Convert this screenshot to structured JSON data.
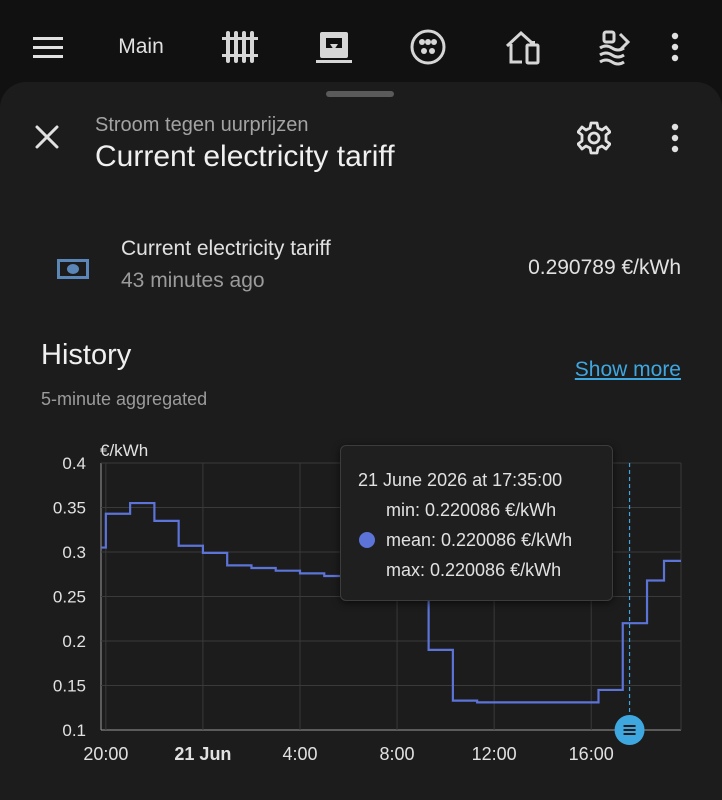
{
  "topbar": {
    "tab_label": "Main",
    "icons": [
      "menu-icon",
      "radiator-icon",
      "solar-inverter-icon",
      "ev-plug-icon",
      "home-battery-icon",
      "heat-pump-icon",
      "more-vertical-icon"
    ]
  },
  "dialog": {
    "subtitle": "Stroom tegen uurprijzen",
    "title": "Current electricity tariff"
  },
  "entity": {
    "name": "Current electricity tariff",
    "last_changed": "43 minutes ago",
    "state": "0.290789 €/kWh",
    "icon": "cash-icon"
  },
  "history": {
    "title": "History",
    "subtitle": "5-minute aggregated",
    "show_more": "Show more"
  },
  "tooltip": {
    "time": "21 June 2026 at 17:35:00",
    "min": "min: 0.220086 €/kWh",
    "mean": "mean: 0.220086 €/kWh",
    "max": "max: 0.220086 €/kWh"
  },
  "colors": {
    "series": "#5c73d8",
    "accent": "#3ea7e0",
    "background": "#1c1c1c"
  },
  "chart_data": {
    "type": "line",
    "step": true,
    "ylabel": "€/kWh",
    "ylim": [
      0.1,
      0.4
    ],
    "yticks": [
      "0.1",
      "0.15",
      "0.2",
      "0.25",
      "0.3",
      "0.35",
      "0.4"
    ],
    "xlim": [
      -0.2,
      23.7
    ],
    "xticks": [
      {
        "value": 0,
        "label": "20:00",
        "bold": false
      },
      {
        "value": 4,
        "label": "21 Jun",
        "bold": true
      },
      {
        "value": 8,
        "label": "4:00",
        "bold": false
      },
      {
        "value": 12,
        "label": "8:00",
        "bold": false
      },
      {
        "value": 16,
        "label": "12:00",
        "bold": false
      },
      {
        "value": 20,
        "label": "16:00",
        "bold": false
      }
    ],
    "grid": true,
    "legend": "none",
    "hover_x": 21.58,
    "series": [
      {
        "points": [
          [
            -0.2,
            0.305
          ],
          [
            0,
            0.343
          ],
          [
            1,
            0.355
          ],
          [
            2,
            0.335
          ],
          [
            3,
            0.307
          ],
          [
            4,
            0.299
          ],
          [
            5,
            0.285
          ],
          [
            6,
            0.282
          ],
          [
            7,
            0.279
          ],
          [
            8,
            0.276
          ],
          [
            9,
            0.273
          ],
          [
            10,
            0.27
          ],
          [
            11,
            0.268
          ],
          [
            12,
            0.265
          ],
          [
            13,
            0.262
          ],
          [
            13.3,
            0.19
          ],
          [
            14.3,
            0.133
          ],
          [
            15.3,
            0.131
          ],
          [
            20.3,
            0.145
          ],
          [
            21.3,
            0.22
          ],
          [
            22.3,
            0.268
          ],
          [
            23.0,
            0.29
          ],
          [
            23.7,
            0.29
          ]
        ]
      }
    ]
  }
}
